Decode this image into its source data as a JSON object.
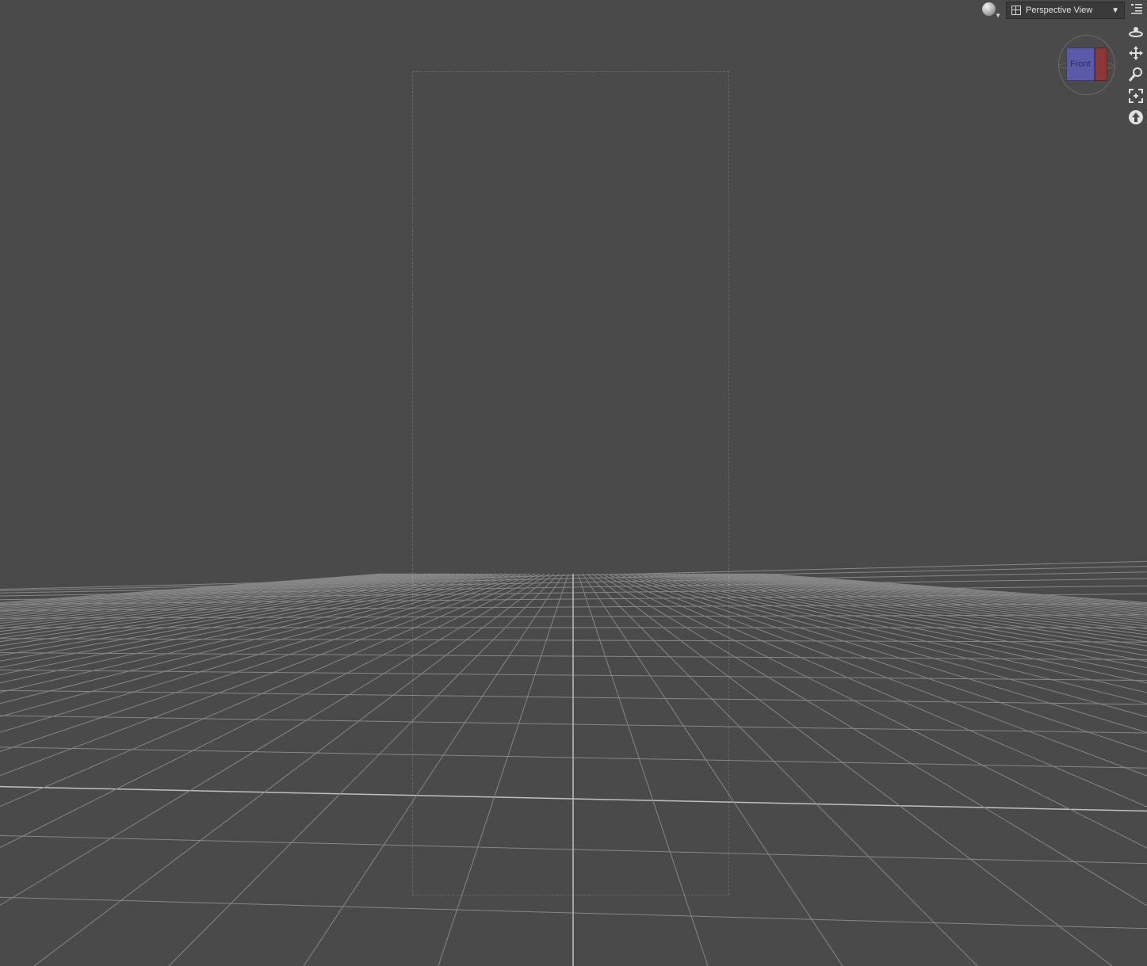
{
  "viewport": {
    "view_label": "Perspective View",
    "cube_face_label": "Front",
    "background_color": "#4a4a4a",
    "grid_color": "#9a9a9a",
    "figure_content": "omitted"
  },
  "icons": {
    "shading": "draw-style-sphere-icon",
    "layout": "viewport-layout-icon",
    "dropdown_arrow": "chevron-down-icon",
    "menu": "viewport-menu-icon",
    "tools": [
      "orbit-icon",
      "pan-icon",
      "zoom-icon",
      "frame-icon",
      "reset-view-icon"
    ]
  }
}
